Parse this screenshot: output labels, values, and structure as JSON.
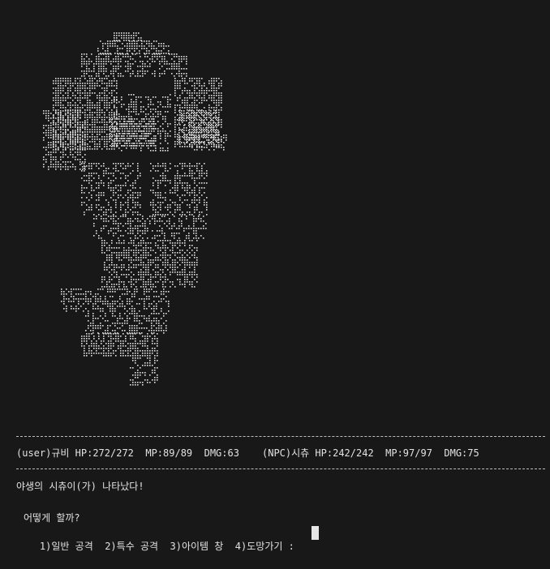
{
  "status": {
    "user": "(user)규비 HP:272/272  MP:89/89  DMG:63",
    "npc": "(NPC)시츄 HP:242/242  MP:97/97  DMG:75"
  },
  "message": "야생의 시츄이(가) 나타났다!",
  "prompt": "어떻게 할까?",
  "menu": {
    "attack": "1)일반 공격",
    "special": "2)특수 공격",
    "item": "3)아이템 창",
    "escape": "4)도망가기 :"
  },
  "art": {
    "subject": "shih-tzu-dog-ascii-braille",
    "color": "#e0e0e0"
  }
}
